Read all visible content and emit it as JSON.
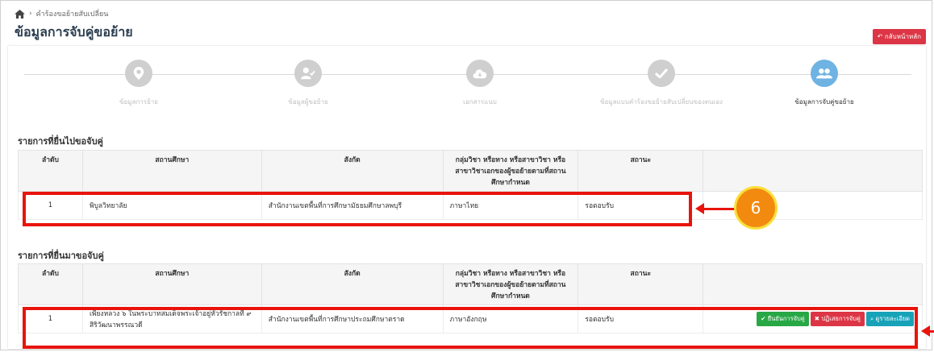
{
  "breadcrumb": {
    "item": "คำร้องขอย้ายสับเปลี่ยน"
  },
  "page": {
    "title": "ข้อมูลการจับคู่ขอย้าย",
    "back_label": "กลับหน้าหลัก"
  },
  "steps": [
    {
      "label": "ข้อมูลการย้าย",
      "icon": "map-marker-icon",
      "active": false
    },
    {
      "label": "ข้อมูลผู้ขอย้าย",
      "icon": "user-check-icon",
      "active": false
    },
    {
      "label": "เอกสารแนบ",
      "icon": "cloud-download-icon",
      "active": false
    },
    {
      "label": "ข้อมูลแบบคำร้องขอย้ายสับเปลี่ยนของตนเอง",
      "icon": "check-icon",
      "active": false
    },
    {
      "label": "ข้อมูลการจับคู่ขอย้าย",
      "icon": "users-icon",
      "active": true
    }
  ],
  "table_headers": [
    "ลำดับ",
    "สถานศึกษา",
    "สังกัด",
    "กลุ่มวิชา หรือทาง หรือสาขาวิชา หรือสาขาวิชาเอกของผู้ขอย้ายตามที่สถานศึกษากำหนด",
    "สถานะ",
    ""
  ],
  "sent": {
    "title": "รายการที่ยื่นไปขอจับคู่",
    "rows": [
      {
        "no": "1",
        "school": "พิบูลวิทยาลัย",
        "area": "สำนักงานเขตพื้นที่การศึกษามัธยมศึกษาลพบุรี",
        "subject": "ภาษาไทย",
        "status": "รอตอบรับ"
      }
    ]
  },
  "received": {
    "title": "รายการที่ยื่นมาขอจับคู่",
    "rows": [
      {
        "no": "1",
        "school": "เพียงหลวง ๖ ในพระบาทสมเด็จพระเจ้าอยู่หัวรัชกาลที่ ๙ สิริวัฒนาพรรณวดี",
        "area": "สำนักงานเขตพื้นที่การศึกษาประถมศึกษาตราด",
        "subject": "ภาษาอังกฤษ",
        "status": "รอตอบรับ"
      }
    ],
    "actions": {
      "confirm": "ยืนยันการจับคู่",
      "reject": "ปฏิเสธการจับคู่",
      "detail": "ดูรายละเอียด"
    }
  },
  "annotation": {
    "number": "6"
  },
  "colors": {
    "accent": "#6fb3e3",
    "annotation_red": "#e8140c",
    "badge_orange": "#f38a10"
  }
}
